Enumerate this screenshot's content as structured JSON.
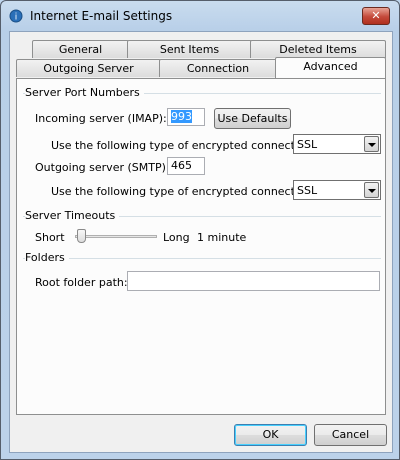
{
  "window": {
    "title": "Internet E-mail Settings",
    "close_label": "✕"
  },
  "tabs_row1": [
    {
      "label": "General"
    },
    {
      "label": "Sent Items"
    },
    {
      "label": "Deleted Items"
    }
  ],
  "tabs_row2": [
    {
      "label": "Outgoing Server"
    },
    {
      "label": "Connection"
    },
    {
      "label": "Advanced"
    }
  ],
  "active_tab": "Advanced",
  "ports": {
    "section_label": "Server Port Numbers",
    "incoming_label": "Incoming server (IMAP):",
    "incoming_value": "993",
    "use_defaults_label": "Use Defaults",
    "incoming_enc_label": "Use the following type of encrypted connection:",
    "incoming_enc_value": "SSL",
    "outgoing_label": "Outgoing server (SMTP):",
    "outgoing_value": "465",
    "outgoing_enc_label": "Use the following type of encrypted connection:",
    "outgoing_enc_value": "SSL"
  },
  "timeouts": {
    "section_label": "Server Timeouts",
    "short_label": "Short",
    "long_label": "Long",
    "value_label": "1 minute",
    "slider_level": 0.0
  },
  "folders": {
    "section_label": "Folders",
    "root_label": "Root folder path:",
    "root_value": ""
  },
  "footer": {
    "ok_label": "OK",
    "cancel_label": "Cancel"
  },
  "colors": {
    "selection": "#3399ff",
    "default_button_glow": "#48d0fe"
  }
}
